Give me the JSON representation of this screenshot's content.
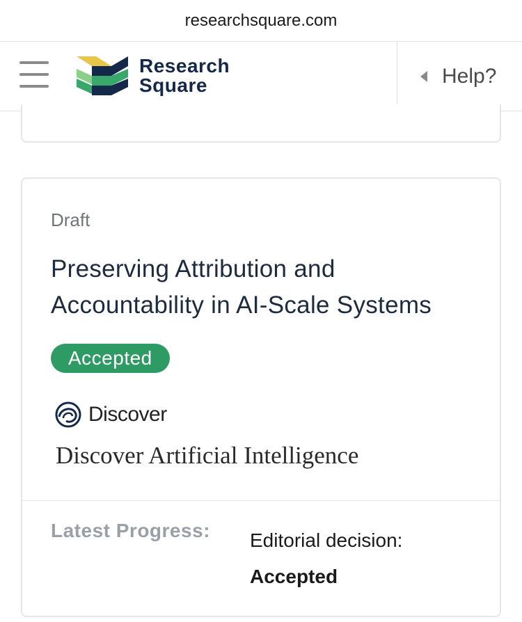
{
  "browser": {
    "url": "researchsquare.com"
  },
  "header": {
    "logo_line1": "Research",
    "logo_line2": "Square",
    "help_label": "Help?"
  },
  "card": {
    "status_label": "Draft",
    "title": "Preserving Attribution and Accountability in AI-Scale Systems",
    "badge": "Accepted",
    "journal_brand": "Discover",
    "journal_name": "Discover Artificial Intelligence",
    "progress_label": "Latest Progress:",
    "progress_line1": "Editorial decision:",
    "progress_line2": "Accepted"
  },
  "colors": {
    "brand_navy": "#14294a",
    "badge_green": "#2f9b64",
    "logo_yellow": "#e8c64a",
    "logo_green": "#3aa86a",
    "logo_light_green": "#8bcf8b"
  },
  "icons": {
    "menu": "hamburger-icon",
    "help": "caret-left-icon",
    "journal": "discover-swirl-icon"
  }
}
